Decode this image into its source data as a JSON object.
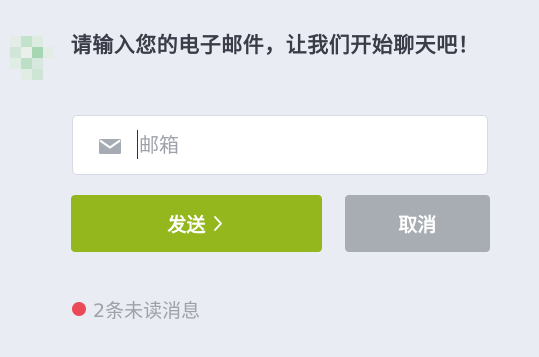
{
  "chat": {
    "prompt": "请输入您的电子邮件，让我们开始聊天吧！"
  },
  "email": {
    "placeholder": "邮箱",
    "value": "",
    "icon": "mail-icon"
  },
  "buttons": {
    "send_label": "发送",
    "send_icon": "chevron-right-icon",
    "cancel_label": "取消"
  },
  "unread": {
    "text": "2条未读消息"
  },
  "colors": {
    "background": "#eaecf4",
    "send": "#93b71c",
    "cancel": "#a8adb3",
    "unread_dot": "#ea4a58",
    "avatar": [
      "#cfe8d4",
      "#9fd4ab",
      "#e6efe8",
      "#b8dec2"
    ]
  }
}
